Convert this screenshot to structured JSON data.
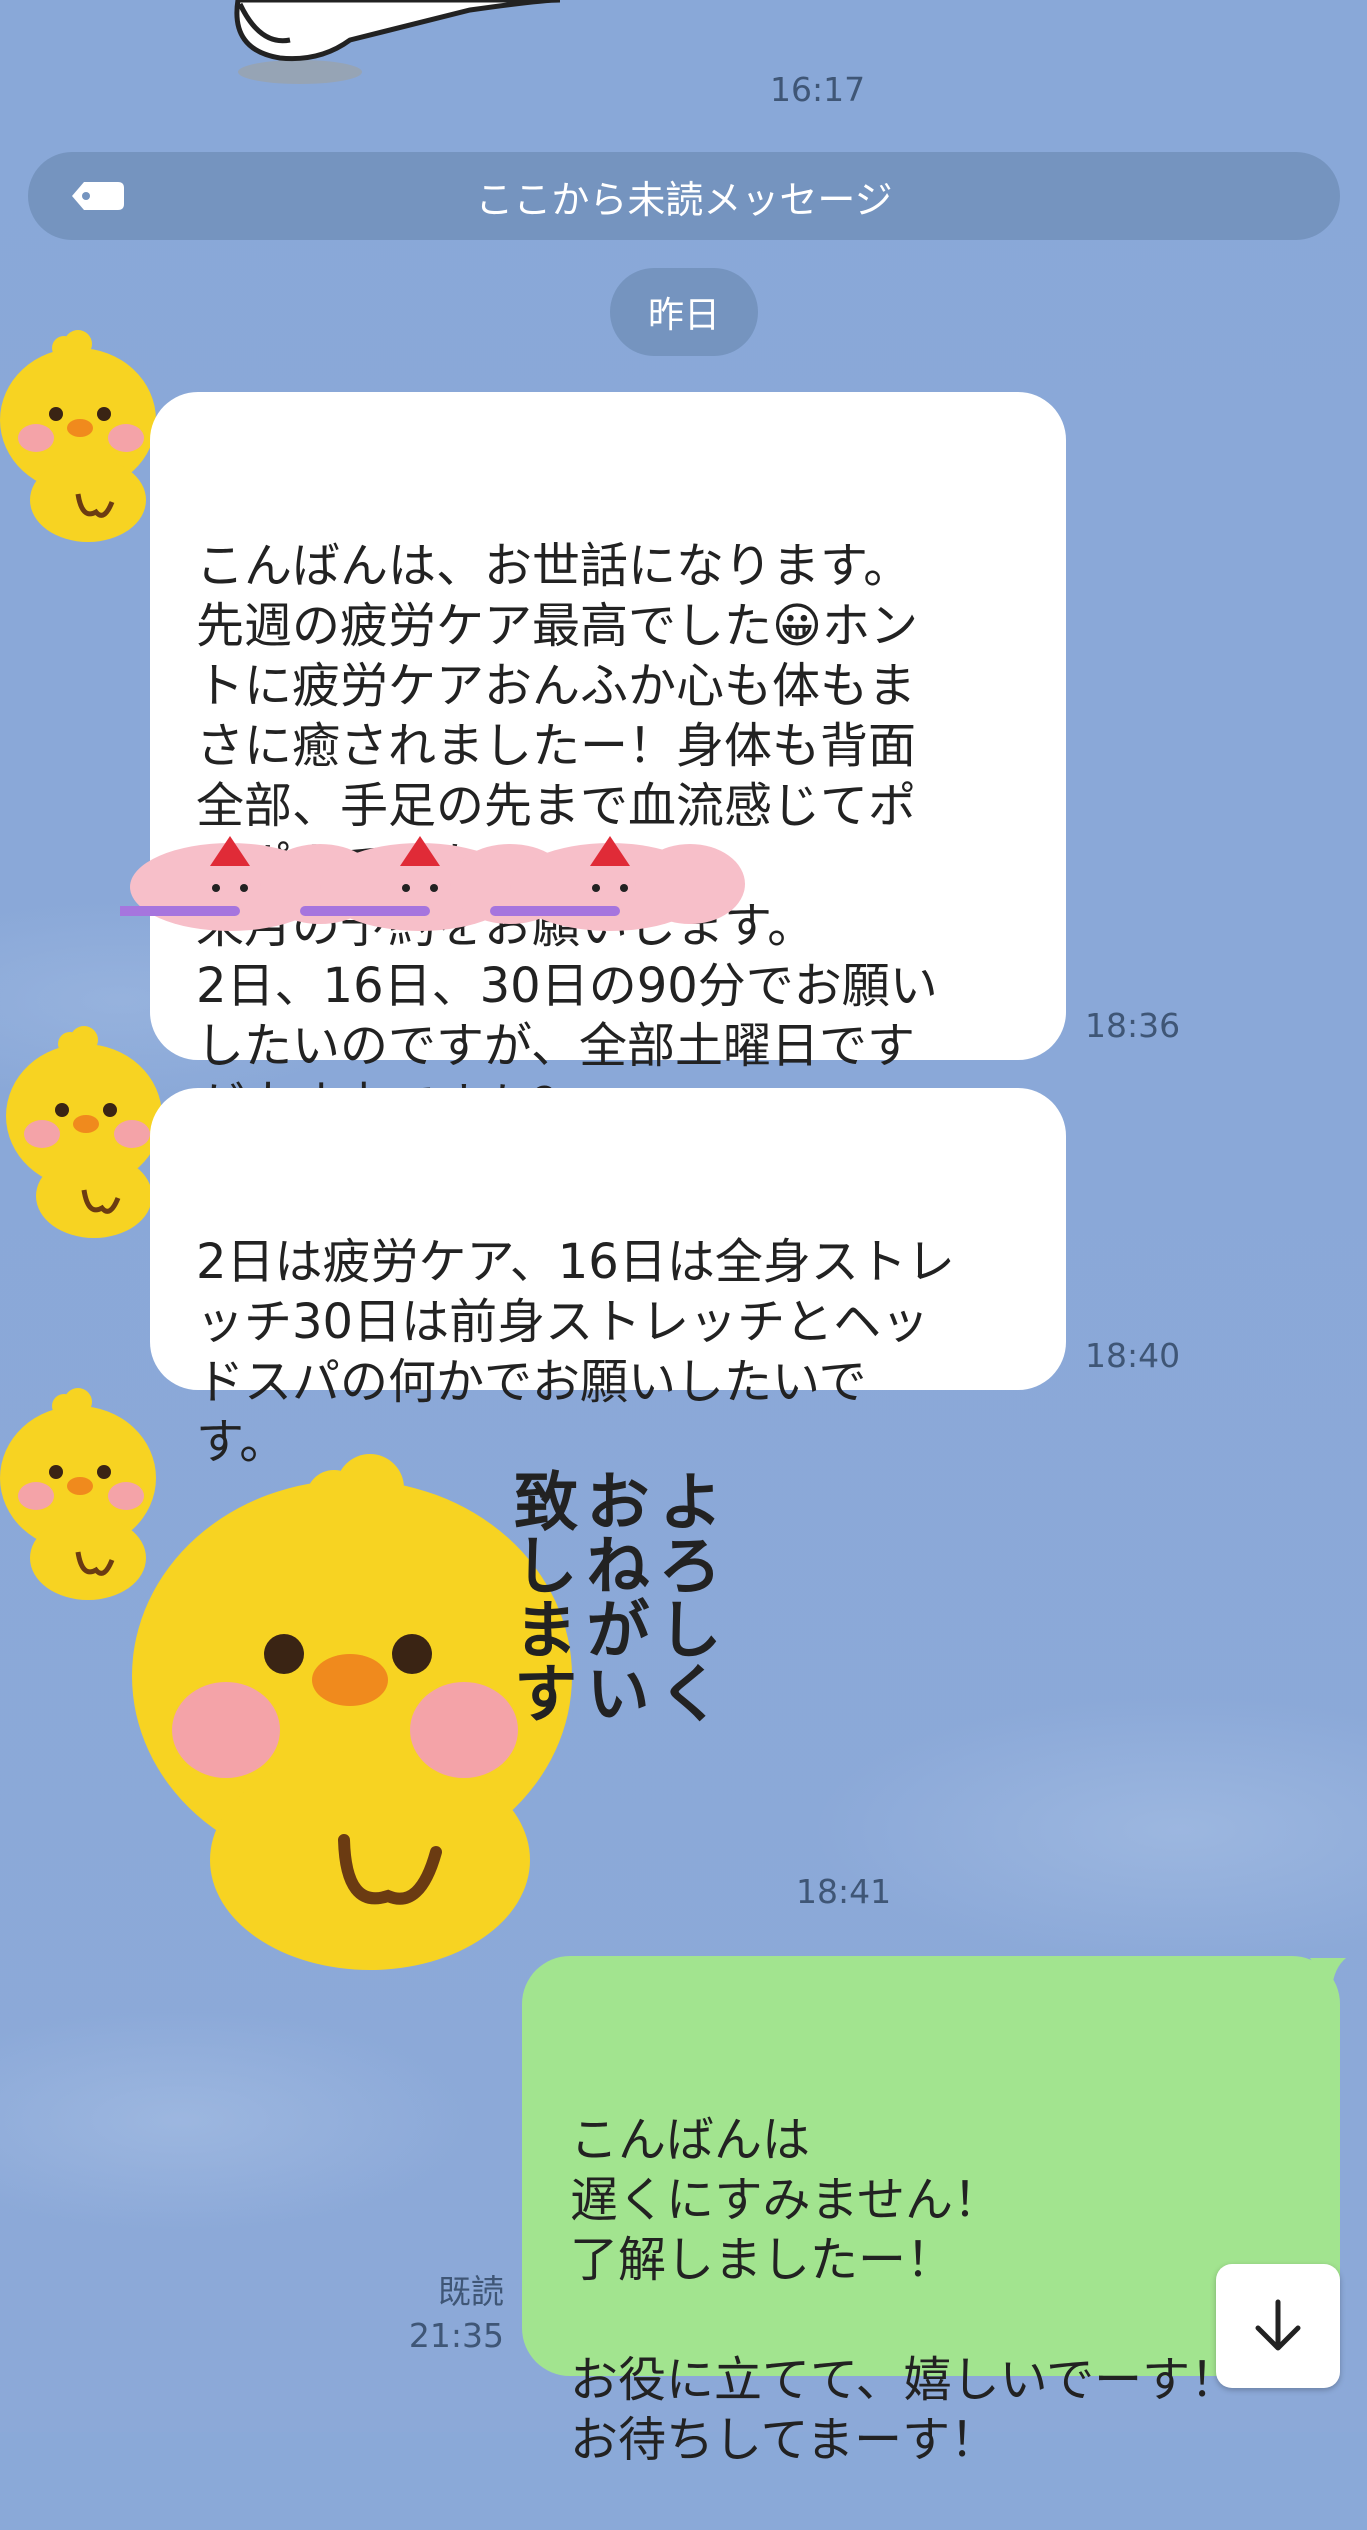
{
  "theme": {
    "background": "#8aa9d8",
    "unread_bar": "#7594bf",
    "incoming_bubble": "#ffffff",
    "outgoing_bubble": "#a2e48f",
    "duck_yellow": "#f7d322"
  },
  "top": {
    "time": "16:17"
  },
  "unread_divider": {
    "label": "ここから未読メッセージ",
    "icon": "tag-icon"
  },
  "date_separator": {
    "label": "昨日"
  },
  "messages": [
    {
      "text": "こんばんは、お世話になります。\n先週の疲労ケア最高でした😀ホン\nトに疲労ケアおんふか心も体もま\nさに癒されましたー！身体も背面\n全部、手足の先まで血流感じてポ\nカポカでした。\n来月の予約をお願いします。\n2日、16日、30日の90分でお願い\nしたいのですが、全部土曜日です\nが大丈夫ですか？",
      "time": "18:36"
    },
    {
      "text": "2日は疲労ケア、16日は全身ストレ\nッチ30日は前身ストレッチとヘッ\nドスパの何かでお願いしたいで\nす。",
      "time": "18:40"
    }
  ],
  "sticker": {
    "text_line1": "よろしく",
    "text_line2": "おねがい",
    "text_line3": "致します",
    "time": "18:41"
  },
  "my_message": {
    "text": "こんばんは\n遅くにすみません！\n了解しましたー！\n\nお役に立てて、嬉しいでーす！\nお待ちしてまーす！",
    "read_label": "既読",
    "time": "21:35"
  },
  "scroll_button": {
    "icon": "arrow-down-icon"
  }
}
